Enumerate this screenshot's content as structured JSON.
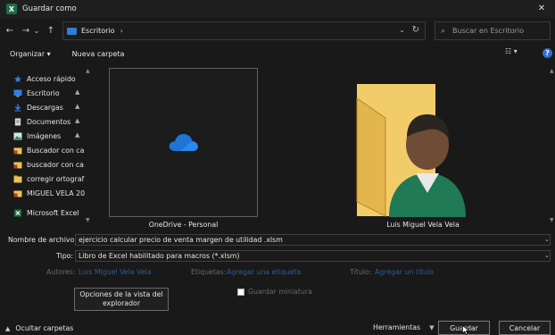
{
  "window": {
    "title": "Guardar como",
    "app_icon_letter": "X",
    "close_glyph": "✕"
  },
  "nav": {
    "back": "←",
    "forward": "→",
    "dropdown": "⌄",
    "up": "↑"
  },
  "address": {
    "path_item": "Escritorio",
    "separator": "›",
    "dropdown": "⌄",
    "refresh": "↻"
  },
  "search": {
    "icon": "⌕",
    "placeholder": "Buscar en Escritorio"
  },
  "toolbar": {
    "organize": "Organizar ▾",
    "new_folder": "Nueva carpeta",
    "view_glyph": "☷ ▾",
    "help": "?"
  },
  "sidebar": {
    "items": [
      {
        "label": "Acceso rápido",
        "icon": "star-icon",
        "color": "#2f7fe6",
        "pinned": false
      },
      {
        "label": "Escritorio",
        "icon": "desktop-icon",
        "color": "#2f7fe6",
        "pinned": true
      },
      {
        "label": "Descargas",
        "icon": "download-icon",
        "color": "#2f7fe6",
        "pinned": true
      },
      {
        "label": "Documentos",
        "icon": "documents-icon",
        "color": "#cfcfcf",
        "pinned": true
      },
      {
        "label": "Imágenes",
        "icon": "pictures-icon",
        "color": "#cfcfcf",
        "pinned": true
      },
      {
        "label": "Buscador con ca",
        "icon": "folder-excel-icon",
        "color": "#e8c45a",
        "pinned": false
      },
      {
        "label": "buscador con ca",
        "icon": "folder-excel-icon",
        "color": "#e8c45a",
        "pinned": false
      },
      {
        "label": "corregir ortograf",
        "icon": "folder-icon",
        "color": "#e8c45a",
        "pinned": false
      },
      {
        "label": "MIGUEL VELA 20",
        "icon": "folder-excel-icon",
        "color": "#e8c45a",
        "pinned": false
      },
      {
        "label": "Microsoft Excel",
        "icon": "excel-icon",
        "color": "#1d6f42",
        "pinned": false
      }
    ],
    "pin_glyph": "📌"
  },
  "content": {
    "tiles": [
      {
        "label": "OneDrive - Personal",
        "icon": "onedrive-cloud-icon"
      },
      {
        "label": "Luis Miguel Vela Vela",
        "icon": "user-folder-icon"
      }
    ]
  },
  "form": {
    "filename_label": "Nombre de archivo:",
    "filename_value": "ejercicio calcular precio de venta margen de utilidad .xlsm",
    "type_label": "Tipo:",
    "type_value": "Libro de Excel habilitado para macros (*.xlsm)",
    "authors_label": "Autores:",
    "authors_value": "Luis Miguel Vela Vela",
    "tags_label": "Etiquetas:",
    "tags_value": "Agregar una etiqueta",
    "title_label": "Título:",
    "title_value": "Agregar un título",
    "explorer_options": "Opciones de la vista del explorador",
    "thumbnail_label": "Guardar miniatura",
    "thumbnail_checked": false
  },
  "footer": {
    "hide_folders": "Ocultar carpetas",
    "tools": "Herramientas",
    "save": "Guardar",
    "cancel": "Cancelar"
  },
  "colors": {
    "accent": "#2f7fe6",
    "background": "#191919",
    "folder": "#e8c45a"
  }
}
